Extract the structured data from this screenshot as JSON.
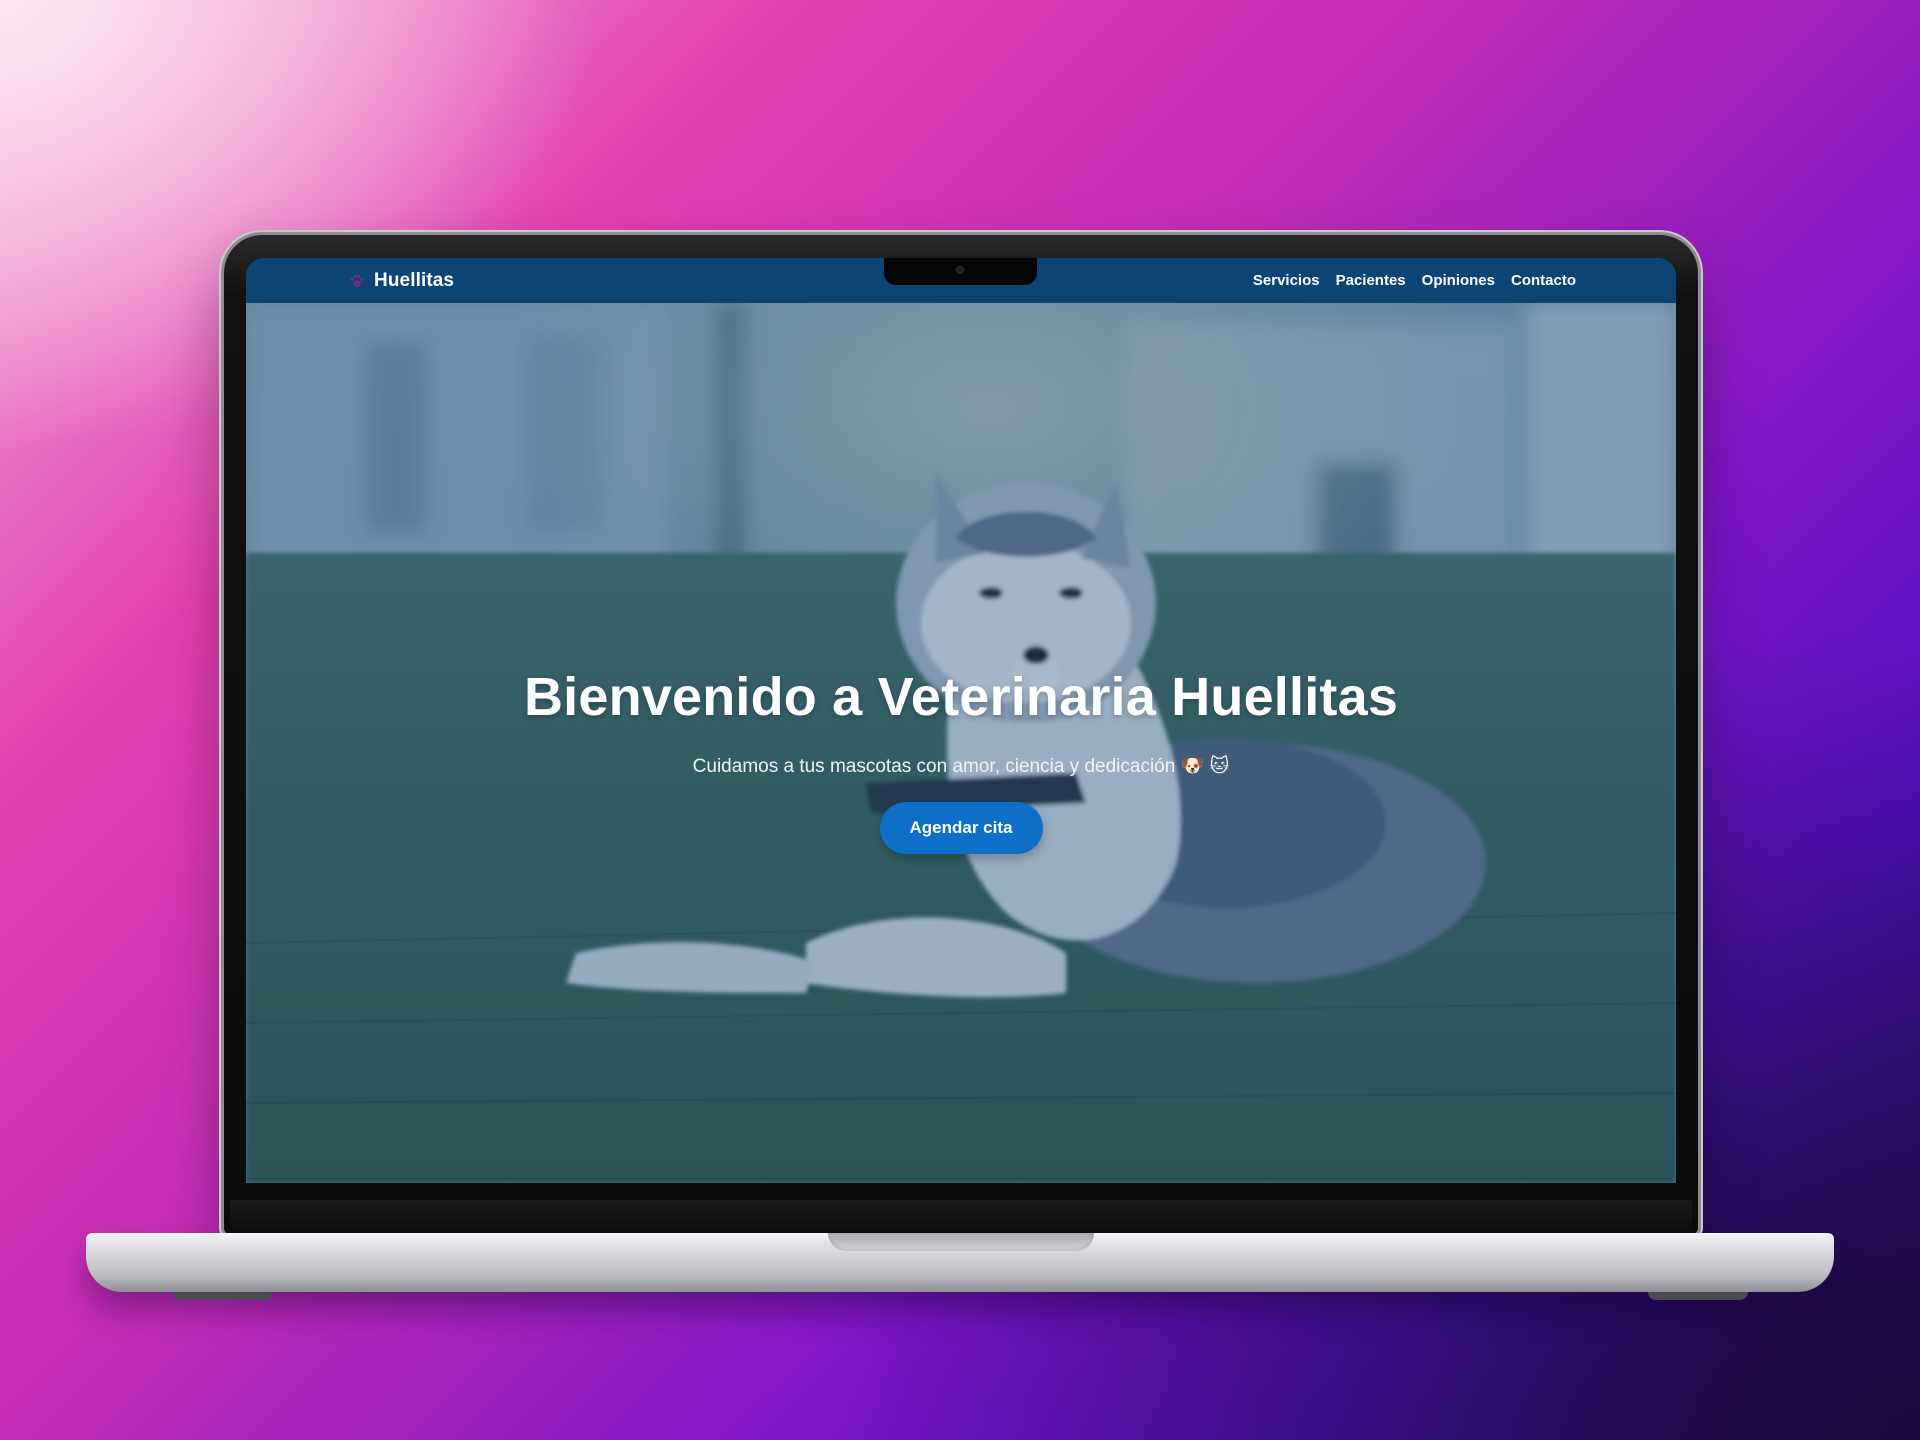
{
  "site": {
    "brand": "Huellitas",
    "nav": [
      {
        "label": "Servicios"
      },
      {
        "label": "Pacientes"
      },
      {
        "label": "Opiniones"
      },
      {
        "label": "Contacto"
      }
    ]
  },
  "hero": {
    "title": "Bienvenido a Veterinaria Huellitas",
    "subtitle": "Cuidamos a tus mascotas con amor, ciencia y dedicación 🐶 🐱",
    "cta_label": "Agendar cita",
    "image": "husky dog lying on grass"
  },
  "colors": {
    "navbar": "#0c4474",
    "cta": "#0d6fc7",
    "background_gradient": [
      "#f3b2d9",
      "#e23fb0",
      "#7e16c6",
      "#2a0b6d"
    ]
  },
  "icons": {
    "brand_icon": "paw-icon"
  }
}
